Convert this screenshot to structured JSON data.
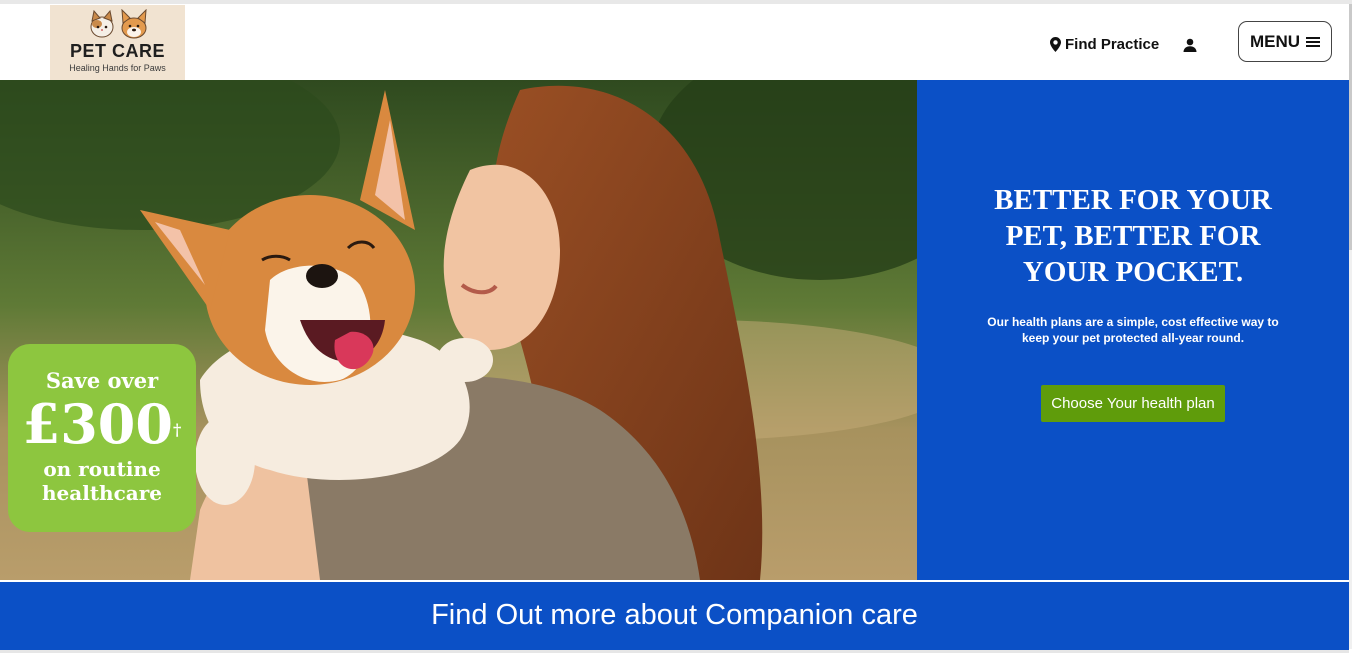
{
  "brand": {
    "name": "PET CARE",
    "tagline": "Healing Hands for Paws"
  },
  "header": {
    "find_practice": "Find Practice",
    "menu_label": "MENU",
    "icons": [
      "map-pin-icon",
      "user-icon",
      "hamburger-icon"
    ]
  },
  "promo": {
    "line1": "Save over",
    "amount": "£300",
    "dagger": "†",
    "line3": "on routine",
    "line4": "healthcare"
  },
  "hero": {
    "title_lines": [
      "BETTER FOR YOUR",
      "PET, BETTER FOR",
      "YOUR POCKET."
    ],
    "description": "Our health plans are a simple, cost effective way to keep your pet protected all-year round.",
    "cta_label": "Choose Your health plan"
  },
  "bottom": {
    "title": "Find Out more about Companion care"
  },
  "colors": {
    "primary_blue": "#0b50c6",
    "promo_green": "#8dc63f",
    "cta_green": "#5f9c0b"
  }
}
